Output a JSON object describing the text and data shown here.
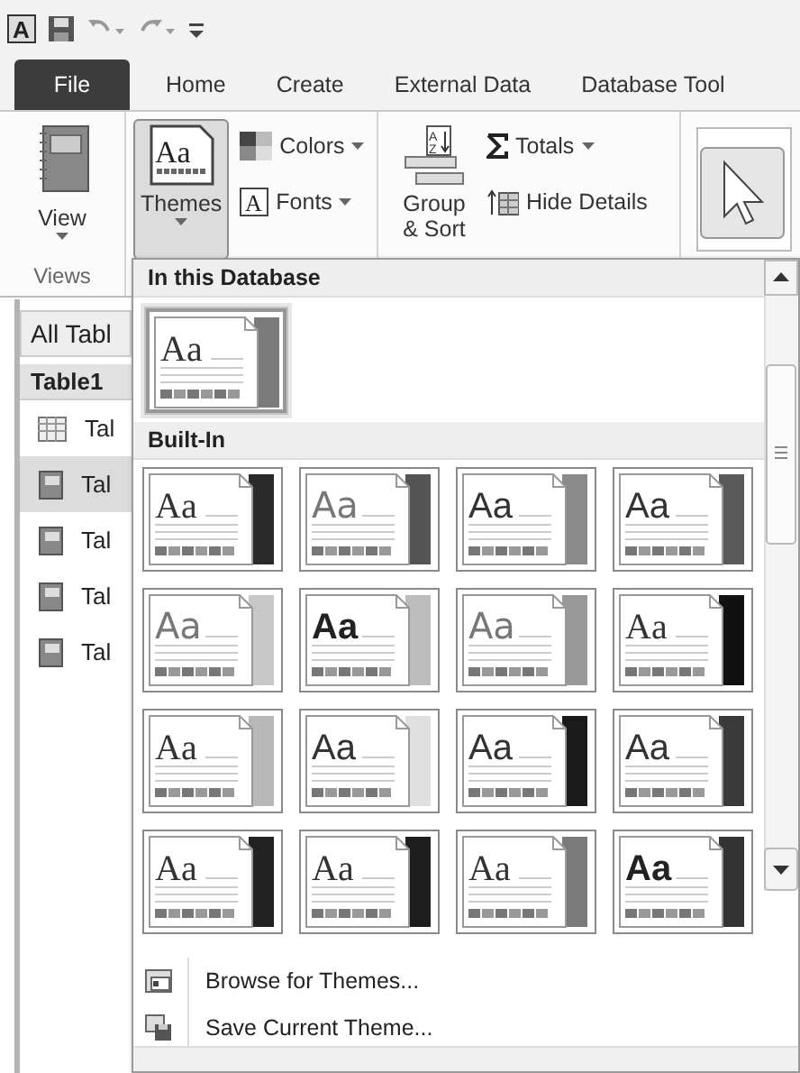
{
  "app_logo": {
    "letter": "A"
  },
  "tabs": [
    {
      "label": "File",
      "kind": "file"
    },
    {
      "label": "Home",
      "kind": "tab"
    },
    {
      "label": "Create",
      "kind": "tab"
    },
    {
      "label": "External Data",
      "kind": "tab"
    },
    {
      "label": "Database Tool",
      "kind": "tab"
    }
  ],
  "ribbon": {
    "views_group": {
      "label": "Views",
      "view_button": {
        "label": "View"
      }
    },
    "themes_button": {
      "label": "Themes",
      "icon_text": "Aa",
      "pressed": true
    },
    "colors_button": {
      "label": "Colors"
    },
    "fonts_button": {
      "label": "Fonts",
      "icon_text": "A"
    },
    "group_sort_button": {
      "label": "Group & Sort",
      "icon_text": [
        "A",
        "Z"
      ]
    },
    "totals_button": {
      "label": "Totals"
    },
    "hide_details_button": {
      "label": "Hide Details"
    }
  },
  "navigation_pane": {
    "header": "All Tabl",
    "group": "Table1",
    "items": [
      {
        "label": "Tal",
        "kind": "table",
        "selected": false
      },
      {
        "label": "Tal",
        "kind": "form",
        "selected": true
      },
      {
        "label": "Tal",
        "kind": "form",
        "selected": false
      },
      {
        "label": "Tal",
        "kind": "form",
        "selected": false
      },
      {
        "label": "Tal",
        "kind": "form",
        "selected": false
      }
    ]
  },
  "themes_gallery": {
    "sections": [
      {
        "title": "In this Database",
        "themes": [
          {
            "sample": "Aa",
            "kind": "serif",
            "color": "#7a7a7a",
            "selected": true
          }
        ]
      },
      {
        "title": "Built-In",
        "themes": [
          {
            "sample": "Aa",
            "kind": "serif",
            "color": "#2a2a2a",
            "selected": false
          },
          {
            "sample": "Aa",
            "kind": "thin",
            "color": "#555555",
            "selected": false
          },
          {
            "sample": "Aa",
            "kind": "sans",
            "color": "#8a8a8a",
            "selected": false
          },
          {
            "sample": "Aa",
            "kind": "sans",
            "color": "#5a5a5a",
            "selected": false
          },
          {
            "sample": "Aa",
            "kind": "thin",
            "color": "#c8c8c8",
            "selected": false
          },
          {
            "sample": "Aa",
            "kind": "bold",
            "color": "#bdbdbd",
            "selected": false
          },
          {
            "sample": "Aa",
            "kind": "thin",
            "color": "#999999",
            "selected": false
          },
          {
            "sample": "Aa",
            "kind": "serif",
            "color": "#111111",
            "selected": false
          },
          {
            "sample": "Aa",
            "kind": "serif",
            "color": "#b8b8b8",
            "selected": false
          },
          {
            "sample": "Aa",
            "kind": "sans",
            "color": "#e0e0e0",
            "selected": false
          },
          {
            "sample": "Aa",
            "kind": "sans",
            "color": "#1a1a1a",
            "selected": false
          },
          {
            "sample": "Aa",
            "kind": "sans",
            "color": "#3a3a3a",
            "selected": false
          },
          {
            "sample": "Aa",
            "kind": "serif",
            "color": "#222222",
            "selected": false
          },
          {
            "sample": "Aa",
            "kind": "serif",
            "color": "#1e1e1e",
            "selected": false
          },
          {
            "sample": "Aa",
            "kind": "serif",
            "color": "#7a7a7a",
            "selected": false
          },
          {
            "sample": "Aa",
            "kind": "bold",
            "color": "#333333",
            "selected": false
          }
        ]
      }
    ],
    "menu": [
      {
        "label": "Browse for Themes..."
      },
      {
        "label": "Save Current Theme..."
      }
    ]
  }
}
